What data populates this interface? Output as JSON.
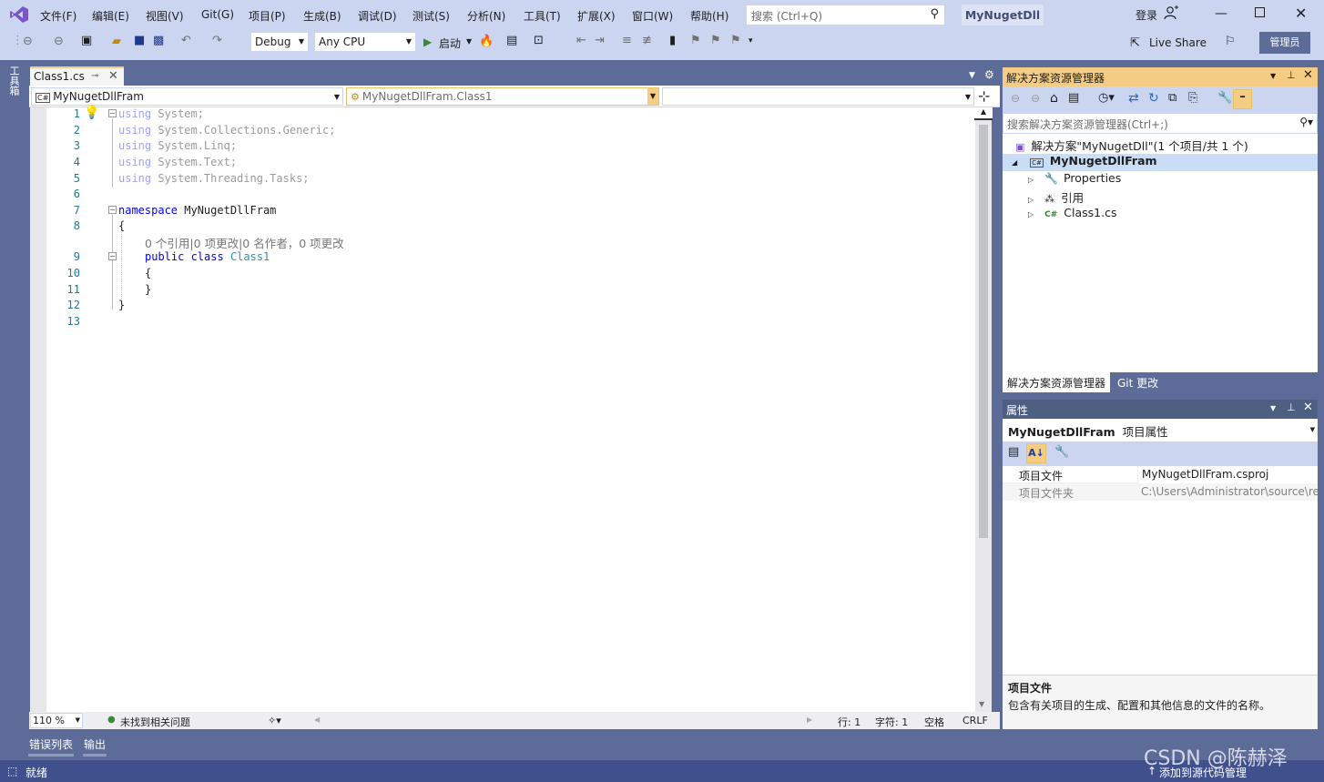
{
  "menu": [
    "文件(F)",
    "编辑(E)",
    "视图(V)",
    "Git(G)",
    "项目(P)",
    "生成(B)",
    "调试(D)",
    "测试(S)",
    "分析(N)",
    "工具(T)",
    "扩展(X)",
    "窗口(W)",
    "帮助(H)"
  ],
  "search": {
    "placeholder": "搜索 (Ctrl+Q)"
  },
  "solution_title": "MyNugetDll",
  "login": "登录",
  "toolbar": {
    "config": "Debug",
    "platform": "Any CPU",
    "start": "启动",
    "live_share": "Live Share",
    "admin": "管理员"
  },
  "toolbox_label": "工具箱",
  "editor": {
    "tab": "Class1.cs",
    "nav_project": "MyNugetDllFram",
    "nav_class": "MyNugetDllFram.Class1",
    "lines": [
      "1",
      "2",
      "3",
      "4",
      "5",
      "6",
      "7",
      "8",
      "9",
      "10",
      "11",
      "12",
      "13"
    ],
    "code": {
      "l1_kw": "using",
      "l1_rest": " System;",
      "l2_kw": "using",
      "l2_rest": " System.Collections.Generic;",
      "l3_kw": "using",
      "l3_rest": " System.Linq;",
      "l4_kw": "using",
      "l4_rest": " System.Text;",
      "l5_kw": "using",
      "l5_rest": " System.Threading.Tasks;",
      "l7_kw": "namespace",
      "l7_rest": " MyNugetDllFram",
      "l8": "{",
      "codelens": "0 个引用|0 项更改|0 名作者，0 项更改",
      "l9_kw": "public class",
      "l9_cls": "Class1",
      "l10": "{",
      "l11": "}",
      "l12": "}"
    },
    "zoom": "110 %",
    "issues": "未找到相关问题",
    "row": "行: 1",
    "col": "字符: 1",
    "spaces": "空格",
    "eol": "CRLF"
  },
  "bottom_tabs": [
    "错误列表",
    "输出"
  ],
  "status": {
    "ready": "就绪",
    "add_source": "添加到源代码管理"
  },
  "solution_explorer": {
    "title": "解决方案资源管理器",
    "search_placeholder": "搜索解决方案资源管理器(Ctrl+;)",
    "solution": "解决方案\"MyNugetDll\"(1 个项目/共 1 个)",
    "project": "MyNugetDllFram",
    "items": [
      "Properties",
      "引用",
      "Class1.cs"
    ],
    "tabs": [
      "解决方案资源管理器",
      "Git 更改"
    ]
  },
  "properties": {
    "title": "属性",
    "object": "MyNugetDllFram",
    "object_type": "项目属性",
    "rows": [
      {
        "name": "项目文件",
        "value": "MyNugetDllFram.csproj"
      },
      {
        "name": "项目文件夹",
        "value": "C:\\Users\\Administrator\\source\\re"
      }
    ],
    "desc_title": "项目文件",
    "desc_text": "包含有关项目的生成、配置和其他信息的文件的名称。"
  },
  "watermark": "CSDN @陈赫泽",
  "colors": {
    "accent": "#f5cc84",
    "chrome": "#ccd5f0",
    "frame": "#5d6b99",
    "statusbar": "#40508d"
  }
}
